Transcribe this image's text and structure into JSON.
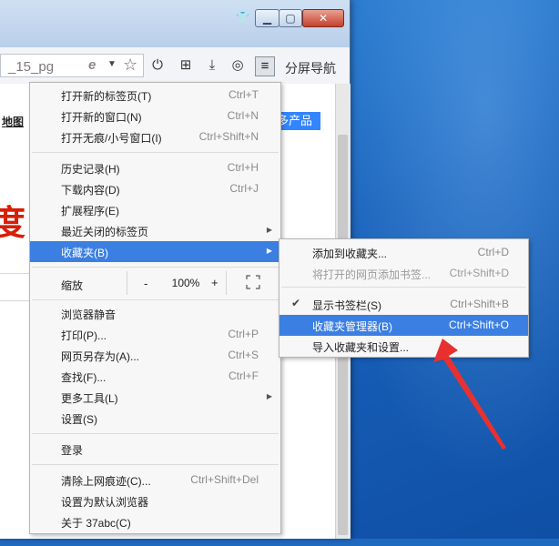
{
  "browser": {
    "url_fragment": "_15_pg",
    "split_nav_label": "分屏导航"
  },
  "page": {
    "map_link": "地图",
    "red_text": "度",
    "more_products": "多产品"
  },
  "main_menu": {
    "items": [
      {
        "label": "打开新的标签页(T)",
        "shortcut": "Ctrl+T"
      },
      {
        "label": "打开新的窗口(N)",
        "shortcut": "Ctrl+N"
      },
      {
        "label": "打开无痕/小号窗口(I)",
        "shortcut": "Ctrl+Shift+N"
      },
      {
        "label": "历史记录(H)",
        "shortcut": "Ctrl+H"
      },
      {
        "label": "下载内容(D)",
        "shortcut": "Ctrl+J"
      },
      {
        "label": "扩展程序(E)",
        "shortcut": ""
      },
      {
        "label": "最近关闭的标签页",
        "shortcut": ""
      },
      {
        "label": "收藏夹(B)",
        "shortcut": ""
      },
      {
        "label": "浏览器静音",
        "shortcut": ""
      },
      {
        "label": "打印(P)...",
        "shortcut": "Ctrl+P"
      },
      {
        "label": "网页另存为(A)...",
        "shortcut": "Ctrl+S"
      },
      {
        "label": "查找(F)...",
        "shortcut": "Ctrl+F"
      },
      {
        "label": "更多工具(L)",
        "shortcut": ""
      },
      {
        "label": "设置(S)",
        "shortcut": ""
      },
      {
        "label": "登录",
        "shortcut": ""
      },
      {
        "label": "清除上网痕迹(C)...",
        "shortcut": "Ctrl+Shift+Del"
      },
      {
        "label": "设置为默认浏览器",
        "shortcut": ""
      },
      {
        "label": "关于 37abc(C)",
        "shortcut": ""
      }
    ],
    "zoom": {
      "label": "缩放",
      "minus": "-",
      "value": "100%",
      "plus": "+"
    }
  },
  "favorites_submenu": {
    "items": [
      {
        "label": "添加到收藏夹...",
        "shortcut": "Ctrl+D"
      },
      {
        "label": "将打开的网页添加书签...",
        "shortcut": "Ctrl+Shift+D"
      },
      {
        "label": "显示书签栏(S)",
        "shortcut": "Ctrl+Shift+B"
      },
      {
        "label": "收藏夹管理器(B)",
        "shortcut": "Ctrl+Shift+O"
      },
      {
        "label": "导入收藏夹和设置...",
        "shortcut": ""
      }
    ]
  },
  "icons": {
    "menu": "hamburger-icon",
    "power": "power-icon",
    "apps": "apps-grid-icon",
    "download": "download-icon",
    "user": "user-icon",
    "star": "star-icon",
    "ie": "ie-compat-icon",
    "check": "check-icon"
  },
  "colors": {
    "highlight": "#3c7fe2",
    "annotation_arrow": "#e8312f",
    "desktop": "#1a64bd"
  }
}
